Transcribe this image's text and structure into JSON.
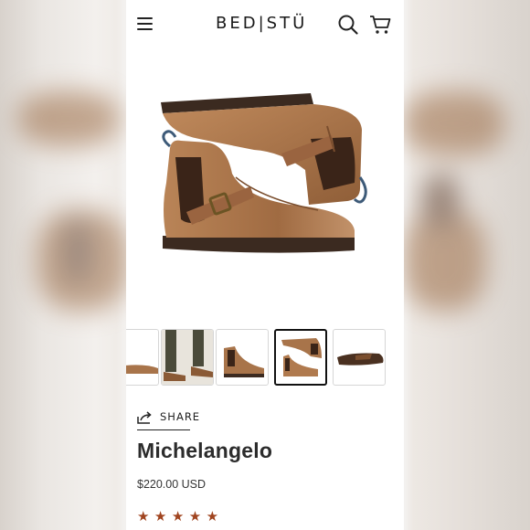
{
  "header": {
    "brand": "BED|STÜ",
    "menu_icon": "hamburger-menu-icon",
    "search_icon": "search-icon",
    "cart_icon": "cart-icon"
  },
  "product": {
    "image_icon": "boot-pair-image",
    "thumbnails": [
      {
        "name": "thumbnail-1",
        "active": false
      },
      {
        "name": "thumbnail-2",
        "active": false
      },
      {
        "name": "thumbnail-3",
        "active": false
      },
      {
        "name": "thumbnail-4",
        "active": true
      },
      {
        "name": "thumbnail-5",
        "active": false
      }
    ],
    "share_label": "SHARE",
    "title": "Michelangelo",
    "price": "$220.00 USD",
    "rating_stars": 5,
    "star_glyph": "★"
  },
  "colors": {
    "star": "#a0441f",
    "leather": "#a8744a",
    "sole": "#3b2a20"
  }
}
